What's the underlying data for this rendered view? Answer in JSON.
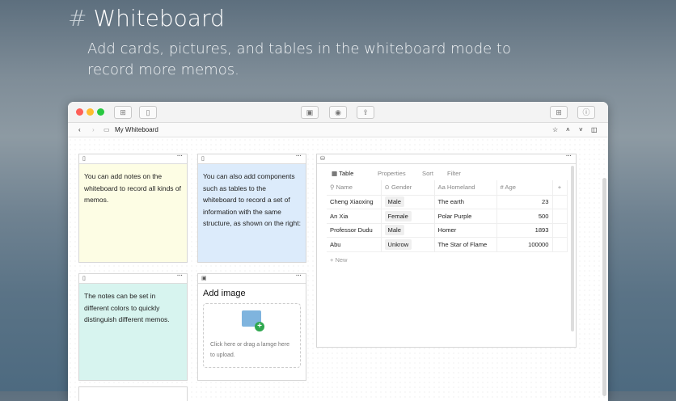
{
  "hero": {
    "hash": "#",
    "title": "Whiteboard",
    "subtitle": "Add cards, pictures, and tables in the whiteboard mode to record more memos."
  },
  "window": {
    "breadcrumb": "My Whiteboard",
    "colors": {
      "close": "#fe5f57",
      "min": "#febc2e",
      "max": "#28c840"
    }
  },
  "cards": [
    {
      "text": "You can add notes on the whiteboard to record all kinds of memos.",
      "color": "#fdfde4"
    },
    {
      "text": "You can also add components such as tables to the whiteboard to record a set of information with the same structure, as shown on the right:",
      "color": "#dcebfb"
    },
    {
      "text": "The notes can be set in different colors to quickly distinguish different memos.",
      "color": "#d7f4ef"
    }
  ],
  "image_card": {
    "title": "Add image",
    "hint": "Click here or drag a lamge here to upload."
  },
  "table": {
    "tabs": [
      "Table",
      "Properties",
      "Sort",
      "Filter"
    ],
    "columns": [
      "Name",
      "Gender",
      "Homeland",
      "Age"
    ],
    "rows": [
      [
        "Cheng Xiaoxing",
        "Male",
        "The earth",
        "23"
      ],
      [
        "An Xia",
        "Female",
        "Polar Purple",
        "500"
      ],
      [
        "Professor Dudu",
        "Male",
        "Homer",
        "1893"
      ],
      [
        "Abu",
        "Unkrow",
        "The Star of Flame",
        "100000"
      ]
    ],
    "new_label": "+ New",
    "add_col": "+"
  }
}
